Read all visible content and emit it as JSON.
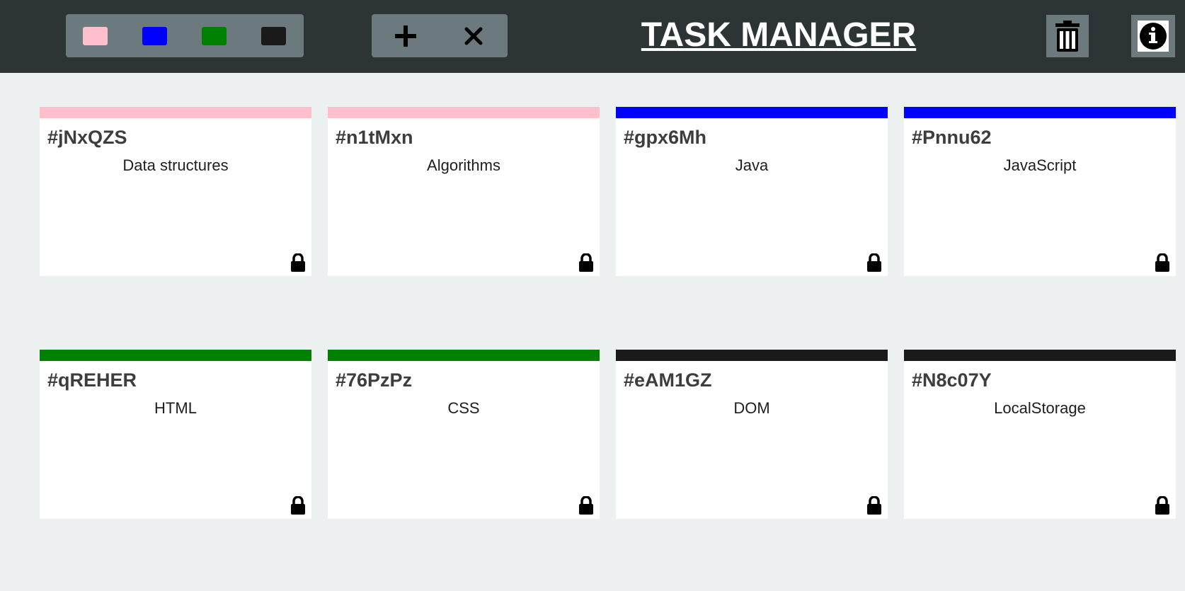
{
  "toolbar": {
    "title": "TASK MANAGER",
    "filters": [
      {
        "name": "pink",
        "color": "#ffc0cb"
      },
      {
        "name": "blue",
        "color": "#0000ff"
      },
      {
        "name": "green",
        "color": "#008000"
      },
      {
        "name": "black",
        "color": "#1a1a1a"
      }
    ],
    "actions": [
      {
        "name": "add",
        "icon": "plus-icon"
      },
      {
        "name": "remove",
        "icon": "close-icon"
      }
    ],
    "trash_icon": "trash-icon",
    "info_icon": "info-icon"
  },
  "tickets": [
    {
      "id": "#jNxQZS",
      "task": "Data structures",
      "color": "#ffc0cb",
      "locked": true
    },
    {
      "id": "#n1tMxn",
      "task": "Algorithms",
      "color": "#ffc0cb",
      "locked": true
    },
    {
      "id": "#gpx6Mh",
      "task": "Java",
      "color": "#0000ff",
      "locked": true
    },
    {
      "id": "#Pnnu62",
      "task": "JavaScript",
      "color": "#0000ff",
      "locked": true
    },
    {
      "id": "#qREHER",
      "task": "HTML",
      "color": "#008000",
      "locked": true
    },
    {
      "id": "#76PzPz",
      "task": "CSS",
      "color": "#008000",
      "locked": true
    },
    {
      "id": "#eAM1GZ",
      "task": "DOM",
      "color": "#1a1a1a",
      "locked": true
    },
    {
      "id": "#N8c07Y",
      "task": "LocalStorage",
      "color": "#1a1a1a",
      "locked": true
    }
  ]
}
